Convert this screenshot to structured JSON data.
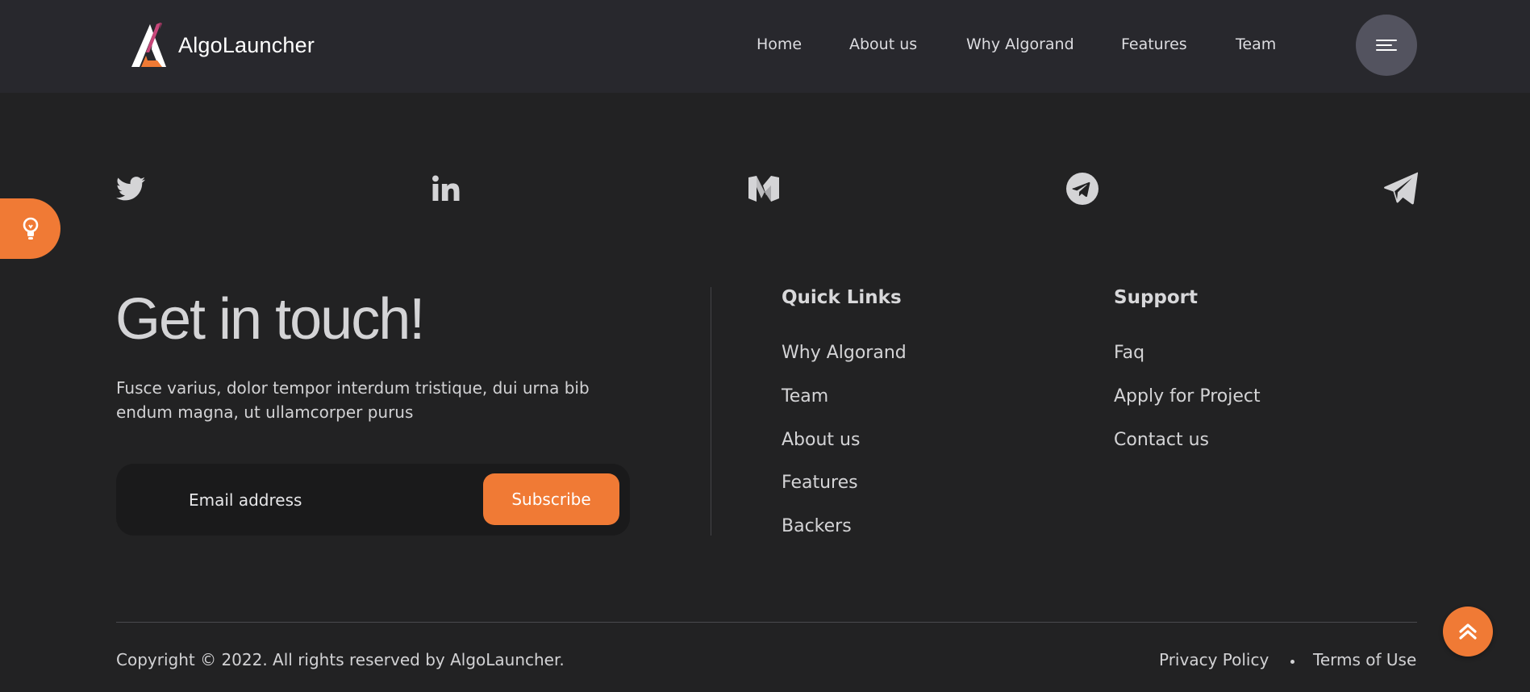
{
  "brand": {
    "name": "AlgoLauncher",
    "accent_color": "#f07a35",
    "logo_icon": "algolauncher-logo"
  },
  "nav": {
    "items": [
      {
        "label": "Home"
      },
      {
        "label": "About us"
      },
      {
        "label": "Why Algorand"
      },
      {
        "label": "Features"
      },
      {
        "label": "Team"
      }
    ],
    "menu_icon": "hamburger-icon"
  },
  "social": [
    {
      "icon": "twitter-icon"
    },
    {
      "icon": "linkedin-icon"
    },
    {
      "icon": "medium-icon"
    },
    {
      "icon": "telegram-icon"
    },
    {
      "icon": "paper-plane-icon"
    }
  ],
  "idea_button": {
    "icon": "lightbulb-icon"
  },
  "contact": {
    "title": "Get in touch!",
    "description": "Fusce varius, dolor tempor interdum tristique, dui urna bib endum magna, ut ullamcorper purus",
    "email_placeholder": "Email address",
    "subscribe_label": "Subscribe"
  },
  "quick_links": {
    "title": "Quick Links",
    "items": [
      {
        "label": "Why Algorand"
      },
      {
        "label": "Team"
      },
      {
        "label": "About us"
      },
      {
        "label": "Features"
      },
      {
        "label": "Backers"
      }
    ]
  },
  "support": {
    "title": "Support",
    "items": [
      {
        "label": "Faq"
      },
      {
        "label": "Apply for Project"
      },
      {
        "label": "Contact us"
      }
    ]
  },
  "footer": {
    "copyright": "Copyright © 2022. All rights reserved by AlgoLauncher.",
    "privacy": "Privacy Policy",
    "terms": "Terms of Use",
    "back_to_top_icon": "double-chevron-up-icon"
  }
}
